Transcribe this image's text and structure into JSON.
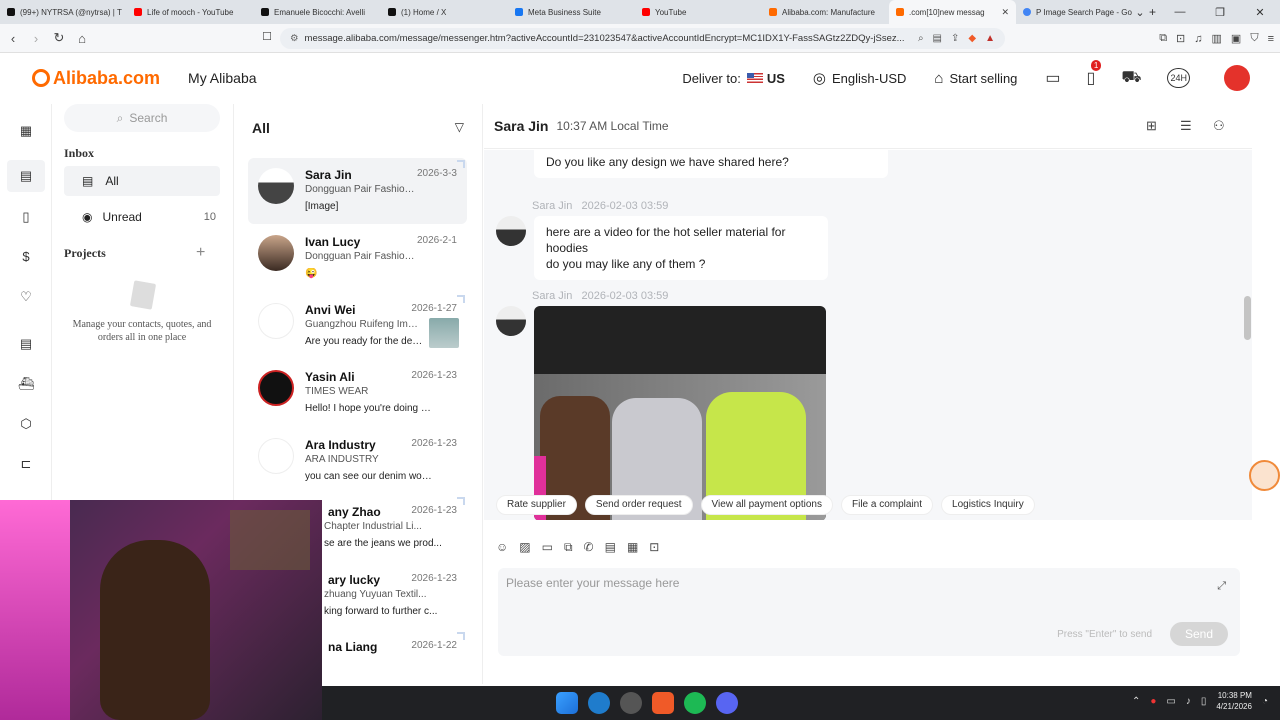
{
  "browser": {
    "tabs": [
      {
        "title": "(99+) NYTRSA (@nytrsa) | T",
        "color": "#111111"
      },
      {
        "title": "Life of mooch - YouTube",
        "color": "#ff0000"
      },
      {
        "title": "Emanuele Bicocchi: Avelli",
        "color": "#111111"
      },
      {
        "title": "(1) Home / X",
        "color": "#111111"
      },
      {
        "title": "Meta Business Suite",
        "color": "#1877f2"
      },
      {
        "title": "YouTube",
        "color": "#ff0000"
      },
      {
        "title": "Alibaba.com: Manufacture",
        "color": "#ff6a00"
      },
      {
        "title": ".com[10]new messag",
        "color": "#ff6a00",
        "active": true
      },
      {
        "title": "P Image Search Page - Go",
        "color": "#4285f4"
      }
    ],
    "url": "message.alibaba.com/message/messenger.htm?activeAccountId=231023547&activeAccountIdEncrypt=MC1IDX1Y-FassSAGtz2ZDQy-jSsez..."
  },
  "header": {
    "logo": "Alibaba.com",
    "my_alibaba": "My Alibaba",
    "deliver_label": "Deliver to:",
    "deliver_country": "US",
    "language": "English-USD",
    "start_selling": "Start selling",
    "orders_badge": "1",
    "service_label": "24H"
  },
  "inbox": {
    "search_placeholder": "Search",
    "inbox_heading": "Inbox",
    "all_label": "All",
    "unread_label": "Unread",
    "unread_count": "10",
    "projects_heading": "Projects",
    "projects_hint": "Manage your contacts, quotes, and orders all in one place"
  },
  "contacts": {
    "title": "All",
    "items": [
      {
        "name": "Sara Jin",
        "date": "2026-3-3",
        "company": "Dongguan Pair Fashion ...",
        "message": "[Image]"
      },
      {
        "name": "Ivan Lucy",
        "date": "2026-2-1",
        "company": "Dongguan Pair Fashion ...",
        "message": "😜"
      },
      {
        "name": "Anvi Wei",
        "date": "2026-1-27",
        "company": "Guangzhou Ruifeng Imp...",
        "message": "Are you ready for the design"
      },
      {
        "name": "Yasin Ali",
        "date": "2026-1-23",
        "company": "TIMES WEAR",
        "message": "Hello! I hope you're doing we..."
      },
      {
        "name": "Ara Industry",
        "date": "2026-1-23",
        "company": "ARA INDUSTRY",
        "message": "you can see our denim works"
      },
      {
        "name": "any Zhao",
        "date": "2026-1-23",
        "company": "Chapter Industrial Li...",
        "message": "se are the jeans we prod..."
      },
      {
        "name": "ary lucky",
        "date": "2026-1-23",
        "company": "zhuang Yuyuan Textil...",
        "message": "king forward to further c..."
      },
      {
        "name": "na Liang",
        "date": "2026-1-22",
        "company": "",
        "message": ""
      }
    ]
  },
  "chat": {
    "contact_name": "Sara Jin",
    "local_time": "10:37 AM Local Time",
    "messages": [
      {
        "text": "Do you like any design we have shared here?"
      },
      {
        "sender": "Sara Jin",
        "time": "2026-02-03 03:59",
        "text_line1": "here are a video for the hot seller material for hoodies",
        "text_line2": "do you may like any of them ?"
      },
      {
        "sender": "Sara Jin",
        "time": "2026-02-03 03:59"
      }
    ],
    "quick_actions": [
      "Rate supplier",
      "Send order request",
      "View all payment options",
      "File a complaint",
      "Logistics Inquiry"
    ],
    "input_placeholder": "Please enter your message here",
    "send_hint": "Press \"Enter\" to send",
    "send_label": "Send"
  },
  "taskbar": {
    "time": "10:38 PM",
    "date": "4/21/2026"
  }
}
